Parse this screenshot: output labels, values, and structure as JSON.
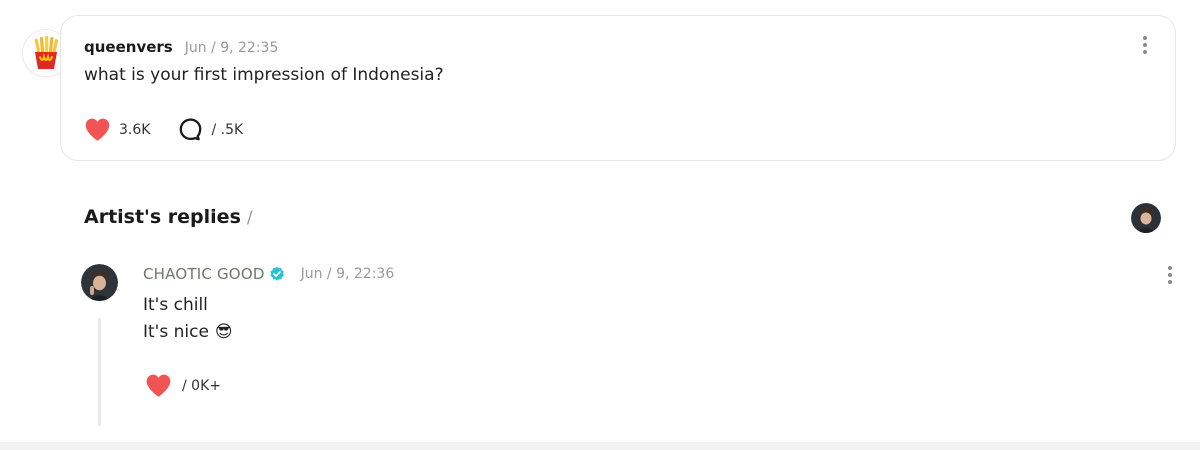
{
  "post": {
    "avatar_icon": "fries-icon",
    "username": "queenvers",
    "timestamp": "Jun / 9, 22:35",
    "question": "what is your first impression of Indonesia?",
    "likes": "3.6K",
    "comments": "/ .5K",
    "like_icon": "heart-icon",
    "comment_icon": "speech-bubble-icon",
    "menu_icon": "more-vertical-icon"
  },
  "replies": {
    "title": "Artist's replies",
    "count": "/",
    "items": [
      {
        "author": "CHAOTIC GOOD",
        "verified": true,
        "timestamp": "Jun / 9, 22:36",
        "lines": [
          "It's chill",
          "It's nice"
        ],
        "emoji": "😎",
        "likes": "/ 0K+",
        "menu_icon": "more-vertical-icon"
      }
    ]
  },
  "colors": {
    "heart": "#f05454",
    "verified": "#25c2d3",
    "border": "#e6e6e6",
    "muted": "#9a9a9a",
    "author": "#6d7a68"
  }
}
